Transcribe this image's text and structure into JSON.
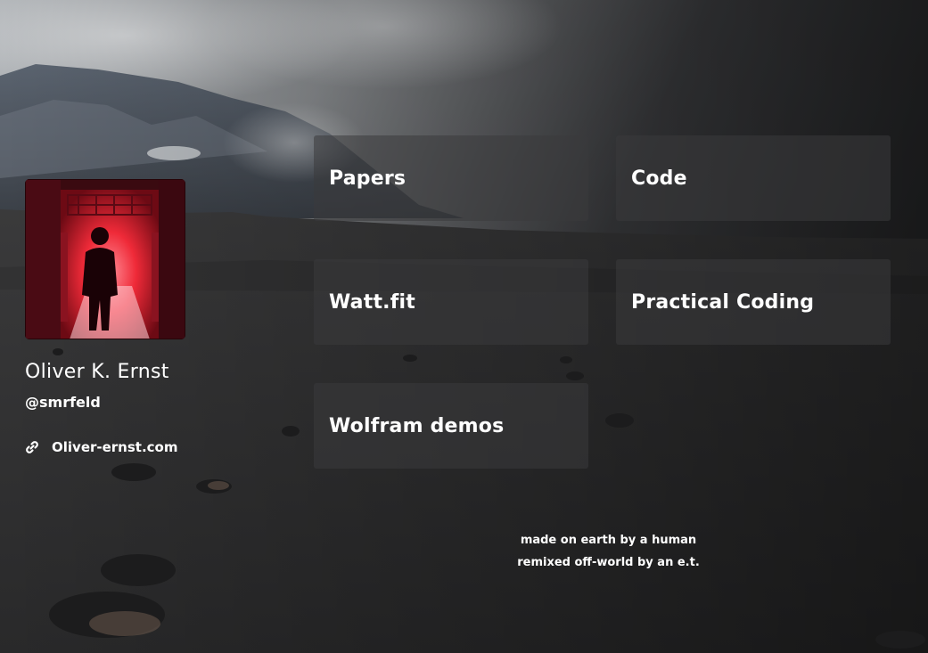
{
  "profile": {
    "name": "Oliver K. Ernst",
    "handle": "@smrfeld",
    "website": "Oliver-ernst.com"
  },
  "tiles": [
    {
      "label": "Papers"
    },
    {
      "label": "Code"
    },
    {
      "label": "Watt.fit"
    },
    {
      "label": "Practical Coding"
    },
    {
      "label": "Wolfram demos"
    }
  ],
  "footer": {
    "line1": "made on earth by a human",
    "line2": "remixed off-world by an e.t."
  },
  "colors": {
    "text": "#ffffff",
    "tile_bg": "rgba(58,58,60,0.55)",
    "avatar_accent": "#e8202c"
  },
  "icons": {
    "website": "link-icon"
  }
}
